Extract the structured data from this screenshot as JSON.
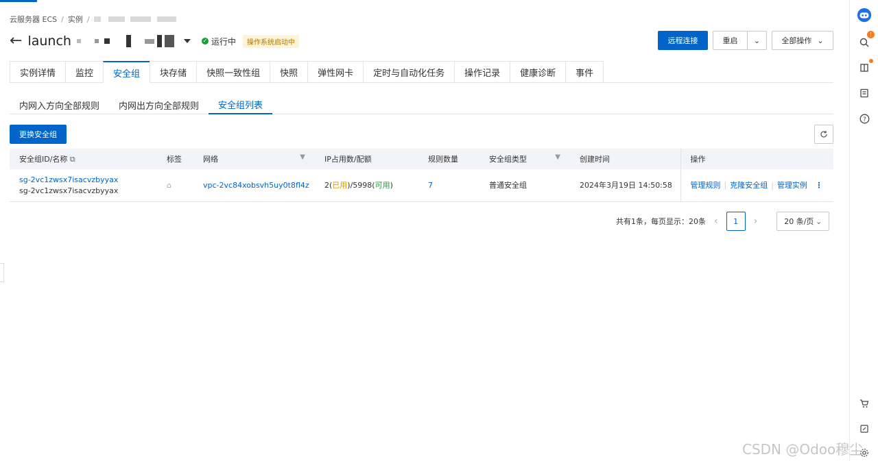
{
  "breadcrumb": {
    "items": [
      "云服务器 ECS",
      "实例"
    ]
  },
  "instance": {
    "name": "launch",
    "status": "运行中",
    "status_tag": "操作系统启动中"
  },
  "actions": {
    "remote": "远程连接",
    "restart": "重启",
    "more_caret": "⌄",
    "all_ops": "全部操作",
    "all_ops_caret": "⌄"
  },
  "tabs": [
    "实例详情",
    "监控",
    "安全组",
    "块存储",
    "快照一致性组",
    "快照",
    "弹性网卡",
    "定时与自动化任务",
    "操作记录",
    "健康诊断",
    "事件"
  ],
  "subtabs": [
    "内网入方向全部规则",
    "内网出方向全部规则",
    "安全组列表"
  ],
  "toolbar": {
    "change_sg": "更换安全组",
    "refresh_icon": "refresh-icon"
  },
  "table": {
    "headers": [
      "安全组ID/名称",
      "标签",
      "网络",
      "IP占用数/配额",
      "规则数量",
      "安全组类型",
      "创建时间",
      "操作"
    ],
    "row": {
      "sg_id": "sg-2vc1zwsx7isacvzbyyax",
      "sg_name": "sg-2vc1zwsx7isacvzbyyax",
      "vpc": "vpc-2vc84xobsvh5uy0t8fl4z",
      "ip_used": "2",
      "ip_used_label": "已用",
      "ip_quota": "5998",
      "ip_avail_label": "可用",
      "rule_count": "7",
      "sg_type": "普通安全组",
      "created": "2024年3月19日 14:50:58",
      "ops": [
        "管理规则",
        "克隆安全组",
        "管理实例"
      ]
    }
  },
  "pager": {
    "summary": "共有1条，每页显示：20条",
    "page": "1",
    "size": "20 条/页"
  },
  "watermark": "CSDN @Odoo穆尘",
  "accent": "#0064c8"
}
